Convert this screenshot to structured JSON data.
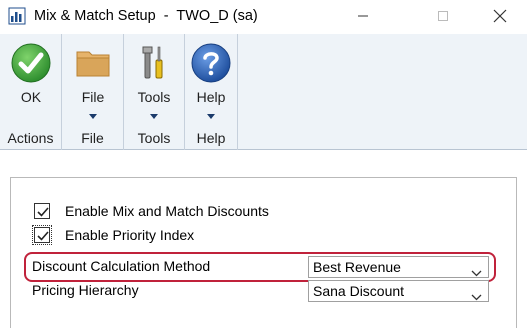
{
  "window": {
    "title": "Mix & Match Setup  -  TWO_D (sa)"
  },
  "ribbon": {
    "groups": [
      {
        "label": "Actions",
        "button": {
          "label": "OK",
          "icon": "ok-check-icon"
        }
      },
      {
        "label": "File",
        "button": {
          "label": "File",
          "icon": "folder-icon"
        }
      },
      {
        "label": "Tools",
        "button": {
          "label": "Tools",
          "icon": "tools-icon"
        }
      },
      {
        "label": "Help",
        "button": {
          "label": "Help",
          "icon": "help-question-icon"
        }
      }
    ]
  },
  "options": {
    "enable_mix_match": {
      "label": "Enable Mix and Match Discounts",
      "checked": true
    },
    "enable_priority_index": {
      "label": "Enable Priority Index",
      "checked": true
    }
  },
  "fields": {
    "discount_calc_method": {
      "label": "Discount Calculation Method",
      "value": "Best Revenue"
    },
    "pricing_hierarchy": {
      "label": "Pricing Hierarchy",
      "value": "Sana Discount"
    }
  },
  "colors": {
    "ok_green": "#3aa23a",
    "help_blue": "#2a5fb0",
    "folder_tan": "#d9a55a",
    "highlight_red": "#c0223b",
    "ribbon_bg": "#eef3f8"
  }
}
